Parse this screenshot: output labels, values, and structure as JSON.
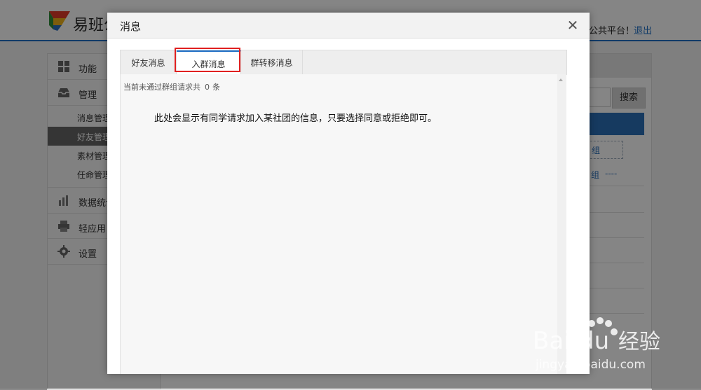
{
  "background_app": {
    "logo_text": "易班公",
    "welcome_text": "公共平台！",
    "logout_label": "退出",
    "sidebar": {
      "items": [
        {
          "label": "功能",
          "icon": "grid-icon"
        },
        {
          "label": "管理",
          "icon": "inbox-icon"
        },
        {
          "label": "消息管理",
          "active": false
        },
        {
          "label": "好友管理",
          "active": true
        },
        {
          "label": "素材管理",
          "active": false
        },
        {
          "label": "任命管理",
          "active": false
        },
        {
          "label": "数据统计",
          "icon": "bar-chart-icon"
        },
        {
          "label": "轻应用",
          "icon": "printer-icon"
        },
        {
          "label": "设置",
          "icon": "gear-icon"
        }
      ]
    },
    "main": {
      "search_label": "搜索",
      "group_link_1": "组",
      "group_link_2": "组",
      "group_link_dashes": "----"
    }
  },
  "modal": {
    "title": "消息",
    "tabs": [
      {
        "label": "好友消息",
        "active": false
      },
      {
        "label": "入群消息",
        "active": true
      },
      {
        "label": "群转移消息",
        "active": false
      }
    ],
    "count_prefix": "当前未通过群组请求共",
    "count_value": "0",
    "count_unit": "条",
    "description": "此处会显示有同学请求加入某社团的信息，只要选择同意或拒绝即可。"
  },
  "watermark": {
    "brand": "Bai",
    "brand_du": "du",
    "brand_cn": "经验",
    "url": "jingyan.baidu.com"
  },
  "colors": {
    "accent": "#1f6fc5",
    "highlight": "#e02020",
    "overlay": "rgba(0,0,0,0.48)"
  }
}
